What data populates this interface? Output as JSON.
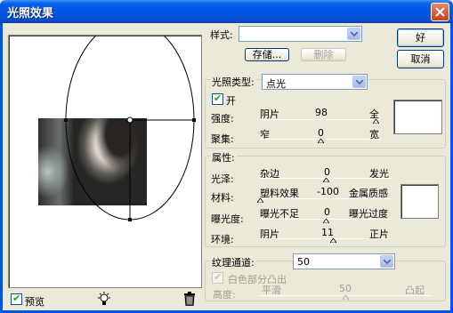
{
  "window": {
    "title": "光照效果"
  },
  "style": {
    "label": "样式:",
    "value": "",
    "save_button": "存储...",
    "delete_button": "删除"
  },
  "buttons": {
    "ok": "好",
    "cancel": "取消"
  },
  "light_type": {
    "label": "光照类型:",
    "value": "点光",
    "on_label": "开",
    "on_checked": true
  },
  "intensity": {
    "label": "强度:",
    "left": "阴片",
    "value": "98",
    "right": "全",
    "fraction": 0.96
  },
  "focus": {
    "label": "聚集:",
    "left": "窄",
    "value": "0",
    "right": "宽",
    "fraction": 0.5
  },
  "properties": {
    "title": "属性:",
    "gloss": {
      "label": "光泽:",
      "left": "杂边",
      "value": "0",
      "right": "发光",
      "fraction": 0.5
    },
    "material": {
      "label": "材料:",
      "left": "塑料效果",
      "value": "-100",
      "right": "金属质感",
      "fraction": 0.0
    },
    "exposure": {
      "label": "曝光度:",
      "left": "曝光不足",
      "value": "0",
      "right": "曝光过度",
      "fraction": 0.5
    },
    "ambience": {
      "label": "环境:",
      "left": "阴片",
      "value": "11",
      "right": "正片",
      "fraction": 0.56
    }
  },
  "texture": {
    "label": "纹理通道:",
    "value": "50",
    "white_high_label": "白色部分凸出",
    "white_high_checked": true,
    "height_label": "高度:",
    "left": "平滑",
    "right": "凸起",
    "fraction": 0.5
  },
  "preview": {
    "label": "预览",
    "checked": true
  },
  "icons": {
    "close": "close-icon",
    "bulb": "light-bulb-icon",
    "trash": "trash-icon",
    "dropdown": "chevron-down-icon"
  },
  "colors": {
    "title_bar": "#0054e3",
    "dialog": "#ece9d8",
    "check": "#21a121"
  }
}
